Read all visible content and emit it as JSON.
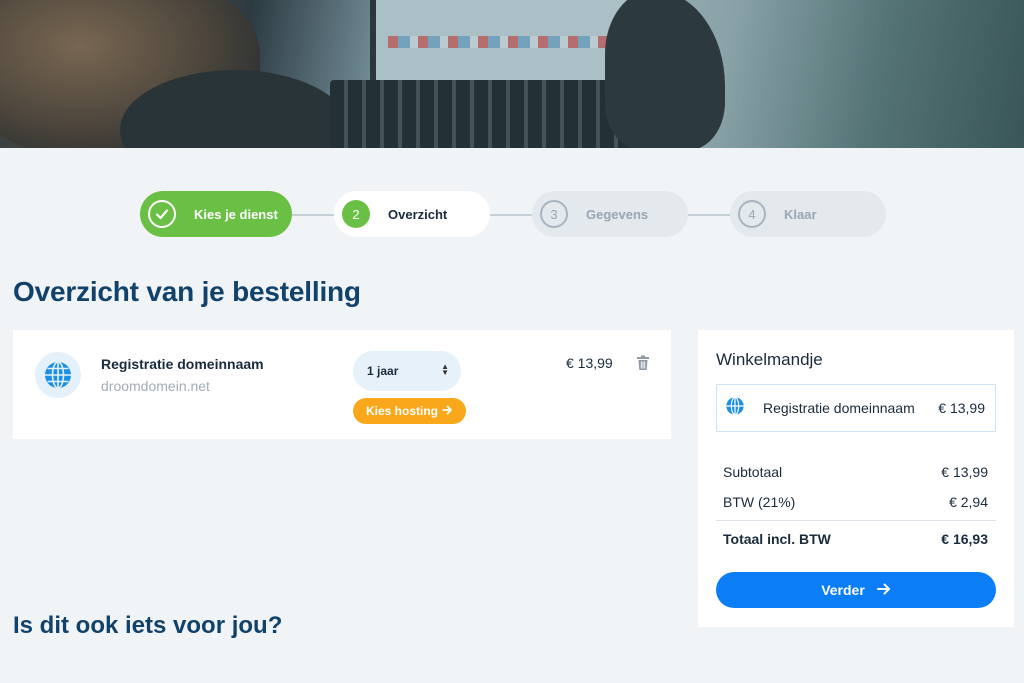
{
  "stepper": {
    "steps": [
      {
        "number": "",
        "label": "Kies je dienst",
        "state": "done"
      },
      {
        "number": "2",
        "label": "Overzicht",
        "state": "active"
      },
      {
        "number": "3",
        "label": "Gegevens",
        "state": "upcoming"
      },
      {
        "number": "4",
        "label": "Klaar",
        "state": "upcoming"
      }
    ]
  },
  "page": {
    "title": "Overzicht van je bestelling",
    "suggestions_title": "Is dit ook iets voor jou?"
  },
  "order": {
    "product_name": "Registratie domeinnaam",
    "domain": "droomdomein.net",
    "period": "1 jaar",
    "hosting_button": "Kies hosting",
    "price": "€ 13,99",
    "icons": {
      "product": "globe-icon",
      "delete": "trash-icon",
      "hosting_arrow": "arrow-right-icon",
      "period_caret": "sort-caret-icon"
    }
  },
  "cart": {
    "title": "Winkelmandje",
    "item": {
      "name": "Registratie domeinnaam",
      "price": "€ 13,99"
    },
    "subtotal_label": "Subtotaal",
    "subtotal_value": "€ 13,99",
    "vat_label": "BTW (21%)",
    "vat_value": "€ 2,94",
    "total_label": "Totaal incl. BTW",
    "total_value": "€ 16,93",
    "next_button": "Verder"
  },
  "colors": {
    "accent_green": "#6ac045",
    "primary_blue": "#0a7df7",
    "hosting_orange": "#f9a81c",
    "heading_navy": "#11426a",
    "background": "#f1f4f7"
  }
}
